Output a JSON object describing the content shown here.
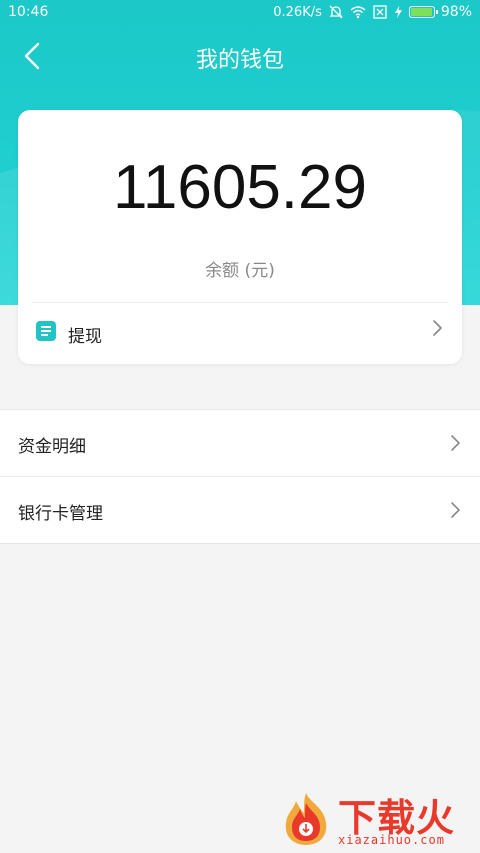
{
  "status_bar": {
    "time": "10:46",
    "net_speed": "0.26K/s",
    "battery_level": "98%",
    "icons": [
      "mute-icon",
      "wifi-icon",
      "sim-off-icon",
      "charging-icon",
      "battery-icon"
    ]
  },
  "nav": {
    "title": "我的钱包",
    "back_icon": "chevron-left-icon"
  },
  "wallet": {
    "balance": "11605.29",
    "balance_label": "余额 (元)",
    "withdraw_label": "提现",
    "withdraw_icon": "document-icon"
  },
  "menu": {
    "items": [
      {
        "label": "资金明细"
      },
      {
        "label": "银行卡管理"
      }
    ]
  },
  "watermark": {
    "brand": "下载火",
    "domain": "xiazaihuo.com"
  },
  "colors": {
    "header": "#20cfd1",
    "accent": "#22c3c4",
    "watermark": "#e8392b"
  }
}
